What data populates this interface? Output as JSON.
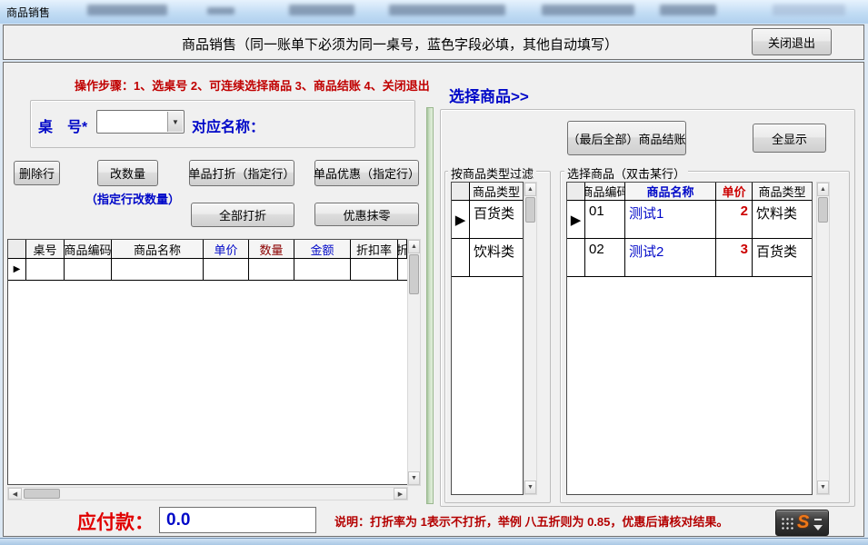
{
  "colors": {
    "accent_blue": "#0008c8",
    "accent_red": "#c00000",
    "price_header_red": "#cc0000",
    "qty_header_dark_red": "#8b0000",
    "payable_red": "#e00000",
    "separator_green": "#cfe2c8",
    "titlebar_blue": "#c2dcf4",
    "ime_orange": "#f07818"
  },
  "icons": {
    "dropdown_arrow": "▼",
    "scroll_up": "▲",
    "scroll_down": "▼",
    "scroll_left": "◀",
    "scroll_right": "▶",
    "row_selector": "▶"
  },
  "window": {
    "titlebar": "商品销售"
  },
  "header": {
    "title": "商品销售（同一账单下必须为同一桌号，蓝色字段必填，其他自动填写）",
    "close_button": "关闭退出"
  },
  "left": {
    "steps": "操作步骤：1、选桌号 2、可连续选择商品 3、商品结账 4、关闭退出",
    "table_no_label": "桌　号*",
    "table_no_value": "",
    "name_label": "对应名称：",
    "buttons": {
      "delete_row": "删除行",
      "change_qty": "改数量",
      "change_qty_hint": "（指定行改数量）",
      "item_discount": "单品打折（指定行）",
      "item_coupon": "单品优惠（指定行）",
      "discount_all": "全部打折",
      "round_off": "优惠抹零"
    },
    "grid": {
      "columns": [
        "桌号",
        "商品编码",
        "商品名称",
        "单价",
        "数量",
        "金额",
        "折扣率",
        "折"
      ],
      "rows": [
        [
          "",
          "",
          "",
          "",
          "",
          "",
          "",
          ""
        ]
      ]
    },
    "payable_label": "应付款：",
    "payable_value": "0.0"
  },
  "right": {
    "title": "选择商品>>",
    "checkout_button": "（最后全部）商品结账",
    "show_all_button": "全显示",
    "filter": {
      "title": "按商品类型过滤",
      "column": "商品类型",
      "rows": [
        "百货类",
        "饮料类"
      ]
    },
    "products": {
      "title": "选择商品（双击某行）",
      "columns": [
        "商品编码",
        "商品名称",
        "单价",
        "商品类型"
      ],
      "rows": [
        {
          "code": "01",
          "name": "测试1",
          "price": "2",
          "type": "饮料类"
        },
        {
          "code": "02",
          "name": "测试2",
          "price": "3",
          "type": "百货类"
        }
      ]
    }
  },
  "footer": {
    "note": "说明：打折率为 1表示不打折，举例 八五折则为 0.85，优惠后请核对结果。",
    "ime_letter": "S"
  }
}
